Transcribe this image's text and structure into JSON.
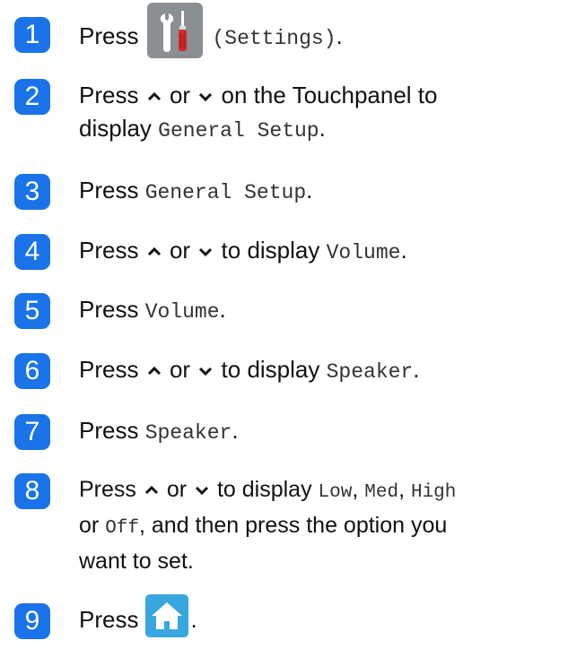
{
  "colors": {
    "badge_bg": "#1a73e8",
    "badge_text": "#ffffff",
    "settings_button_bg": "#8a8f92",
    "home_button_bg": "#39a7df"
  },
  "steps": [
    {
      "number": "1",
      "press": "Press",
      "settings_label": "(Settings)",
      "end": ".",
      "icon": "settings-tools-icon"
    },
    {
      "number": "2",
      "press": "Press",
      "or": "or",
      "rest": "on the Touchpanel to",
      "line2_pre": "display",
      "menu": "General Setup",
      "end": "."
    },
    {
      "number": "3",
      "press": "Press",
      "menu": "General Setup",
      "end": "."
    },
    {
      "number": "4",
      "press": "Press",
      "or": "or",
      "to_display": "to display",
      "menu": "Volume",
      "end": "."
    },
    {
      "number": "5",
      "press": "Press",
      "menu": "Volume",
      "end": "."
    },
    {
      "number": "6",
      "press": "Press",
      "or": "or",
      "to_display": "to display",
      "menu": "Speaker",
      "end": "."
    },
    {
      "number": "7",
      "press": "Press",
      "menu": "Speaker",
      "end": "."
    },
    {
      "number": "8",
      "press": "Press",
      "or": "or",
      "to_display": "to display",
      "opt_low": "Low",
      "comma": ",",
      "opt_med": "Med",
      "opt_high": "High",
      "or2": "or",
      "opt_off": "Off",
      "after": ", and then press the option you",
      "line3": "want to set."
    },
    {
      "number": "9",
      "press": "Press",
      "end": ".",
      "icon": "home-icon"
    }
  ]
}
